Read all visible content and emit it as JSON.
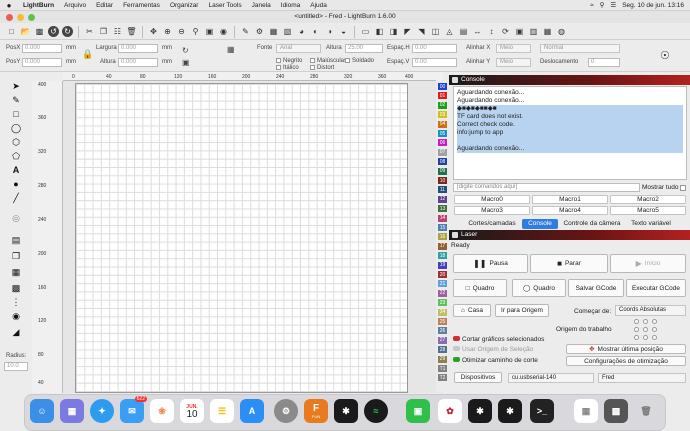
{
  "menubar": {
    "apple": "",
    "app": "LightBurn",
    "items": [
      "Arquivo",
      "Editar",
      "Ferramentas",
      "Organizar",
      "Laser Tools",
      "Janela",
      "Idioma",
      "Ajuda"
    ],
    "datetime": "Seg. 10 de jun.  13:16"
  },
  "window": {
    "title": "<untitled> - Fred - LightBurn 1.6.00"
  },
  "props": {
    "posx_label": "PosX",
    "posx_value": "0.000",
    "posy_label": "PosY",
    "posy_value": "0.000",
    "unit": "mm",
    "largura_label": "Largura",
    "largura_value": "0.000",
    "altura_label": "Altura",
    "altura_value": "0.000",
    "fonte_label": "Fonte",
    "fonte_value": "Arial",
    "font_altura_label": "Altura",
    "font_altura_value": "25.00",
    "esph_label": "Espaç.H",
    "esph_value": "0.00",
    "espv_label": "Espaç.V",
    "espv_value": "0.00",
    "alinhx_label": "Alinhar X",
    "alinhx_value": "Meio",
    "alinhy_label": "Alinhar Y",
    "alinhy_value": "Meio",
    "normal_value": "Normal",
    "desloc_label": "Deslocamento",
    "desloc_value": "0",
    "negrito": "Negrito",
    "italico": "Itálico",
    "maiusculas": "Maiúsculas",
    "distort": "Distort",
    "soldado": "Soldado"
  },
  "ruler": {
    "top": [
      "0",
      "40",
      "80",
      "120",
      "160",
      "200",
      "240",
      "280",
      "320",
      "360",
      "400"
    ],
    "left": [
      "400",
      "360",
      "320",
      "280",
      "240",
      "200",
      "160",
      "120",
      "80",
      "40"
    ]
  },
  "sidebar": {
    "radius_label": "Radius:",
    "radius_value": "10.0"
  },
  "colors": [
    {
      "code": "00",
      "hex": "#1e3fd8"
    },
    {
      "code": "01",
      "hex": "#d82020"
    },
    {
      "code": "02",
      "hex": "#18a018"
    },
    {
      "code": "03",
      "hex": "#d0c020"
    },
    {
      "code": "04",
      "hex": "#d07010"
    },
    {
      "code": "05",
      "hex": "#1890c8"
    },
    {
      "code": "06",
      "hex": "#c020c0"
    },
    {
      "code": "07",
      "hex": "#a0a0a0"
    },
    {
      "code": "08",
      "hex": "#2040a0"
    },
    {
      "code": "09",
      "hex": "#207050"
    },
    {
      "code": "10",
      "hex": "#7a2a1a"
    },
    {
      "code": "11",
      "hex": "#205080"
    },
    {
      "code": "12",
      "hex": "#604090"
    },
    {
      "code": "13",
      "hex": "#407040"
    },
    {
      "code": "14",
      "hex": "#c04070"
    },
    {
      "code": "15",
      "hex": "#5080b0"
    },
    {
      "code": "16",
      "hex": "#b0a040"
    },
    {
      "code": "17",
      "hex": "#906030"
    },
    {
      "code": "18",
      "hex": "#30a0a0"
    },
    {
      "code": "19",
      "hex": "#4040c0"
    },
    {
      "code": "20",
      "hex": "#a03030"
    },
    {
      "code": "21",
      "hex": "#60a0e0"
    },
    {
      "code": "22",
      "hex": "#a060a0"
    },
    {
      "code": "23",
      "hex": "#60c060"
    },
    {
      "code": "24",
      "hex": "#c0c060"
    },
    {
      "code": "25",
      "hex": "#c08060"
    },
    {
      "code": "26",
      "hex": "#6080a0"
    },
    {
      "code": "27",
      "hex": "#8a6ab0"
    },
    {
      "code": "28",
      "hex": "#507090"
    },
    {
      "code": "29",
      "hex": "#908050"
    },
    {
      "code": "T1",
      "hex": "#808080"
    },
    {
      "code": "T2",
      "hex": "#808080"
    }
  ],
  "console": {
    "title": "Console",
    "lines": [
      {
        "text": "Aguardando conexão...",
        "hl": false
      },
      {
        "text": "Aguardando conexão...",
        "hl": false
      },
      {
        "text": "◆■◆■◆■■◆■",
        "hl": true
      },
      {
        "text": "TF card does not exist.",
        "hl": true
      },
      {
        "text": "Correct check code.",
        "hl": true
      },
      {
        "text": "info:jump to app",
        "hl": true
      },
      {
        "text": "",
        "hl": true
      },
      {
        "text": "Aguardando conexão...",
        "hl": true
      }
    ],
    "cmd_placeholder": "[digite comandos aqui]",
    "show_all": "Mostrar tudo",
    "macros": [
      "Macro0",
      "Macro1",
      "Macro2",
      "Macro3",
      "Macro4",
      "Macro5"
    ],
    "tabs": [
      "Cortes/camadas",
      "Console",
      "Controle da câmera",
      "Texto variável"
    ]
  },
  "laser": {
    "title": "Laser",
    "status": "Ready",
    "pausa": "Pausa",
    "parar": "Parar",
    "inicio": "Início",
    "quadro1": "Quadro",
    "quadro2": "Quadro",
    "salvar": "Salvar GCode",
    "executar": "Executar GCode",
    "casa": "Casa",
    "ir_origem": "Ir para Origem",
    "comecar_label": "Começar de:",
    "comecar_value": "Coords Absolutas",
    "origem_label": "Origem do trabalho",
    "cortar": "Cortar gráficos selecionados",
    "usar_origem": "Usar Origem de Seleção",
    "otimizar": "Otimizar caminho de corte",
    "mostrar_pos": "Mostrar última posição",
    "config_otim": "Configurações de otimização",
    "dispositivos": "Dispositivos",
    "port": "cu.usbserial-140",
    "device": "Fred"
  },
  "dock": {
    "mail_badge": "622",
    "calendar_month": "JUN.",
    "calendar_day": "10",
    "lb_label": "FUN"
  }
}
